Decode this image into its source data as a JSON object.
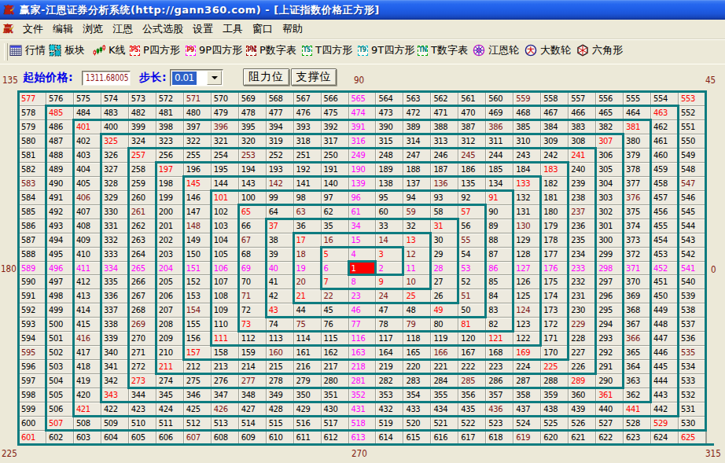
{
  "window": {
    "title": "赢家-江恩证券分析系统(http://gann360.com) - [上证指数价格正方形]",
    "app_icon": "赢"
  },
  "menu": {
    "items": [
      "文件",
      "编辑",
      "浏览",
      "江恩",
      "公式选股",
      "设置",
      "工具",
      "窗口",
      "帮助"
    ]
  },
  "toolbar": {
    "items": [
      {
        "name": "quotes",
        "label": "行情",
        "icon": "table-icon"
      },
      {
        "name": "sectors",
        "label": "板块",
        "icon": "blocks-icon"
      },
      {
        "name": "kline",
        "label": "K线",
        "icon": "candlestick-icon"
      },
      {
        "name": "p-square",
        "label": "P四方形",
        "icon": "badge-icon",
        "badge": "PS",
        "badge_text_color": "#e80000",
        "badge_border_color": "#e80000"
      },
      {
        "name": "9p-square",
        "label": "9P四方形",
        "icon": "badge-icon",
        "badge": "P9",
        "badge_text_color": "#d40000",
        "badge_border_color": "#ff00ff"
      },
      {
        "name": "p-number-table",
        "label": "P数字表",
        "icon": "badge-icon",
        "badge": "PN",
        "badge_text_color": "#8b0000",
        "badge_border_color": "#a00000"
      },
      {
        "name": "t-square",
        "label": "T四方形",
        "icon": "badge-icon",
        "badge": "TS",
        "badge_text_color": "#008080",
        "badge_border_color": "#00a800"
      },
      {
        "name": "9t-square",
        "label": "9T四方形",
        "icon": "badge-icon",
        "badge": "T9",
        "badge_text_color": "#008080",
        "badge_border_color": "#00b8c8"
      },
      {
        "name": "t-number-table",
        "label": "T数字表",
        "icon": "badge-icon",
        "badge": "TN",
        "badge_text_color": "#008080",
        "badge_border_color": "#00a800"
      },
      {
        "name": "gann-wheel",
        "label": "江恩轮",
        "icon": "wheel-icon"
      },
      {
        "name": "big-number-wheel",
        "label": "大数轮",
        "icon": "big-wheel-icon",
        "glyph": "大"
      },
      {
        "name": "hexagon",
        "label": "六角形",
        "icon": "hexagon-icon"
      }
    ]
  },
  "controls": {
    "start_price_label": "起始价格:",
    "start_price_value": "1311.68005",
    "step_label": "步长:",
    "step_value": "0.01",
    "resistance_button_label": "阻力位",
    "support_button_label": "支撑位"
  },
  "angle_labels": {
    "top_left": "135",
    "top_center": "90",
    "top_right": "45",
    "middle_left": "180",
    "middle_right": "0",
    "bottom_left": "225",
    "bottom_center": "270",
    "bottom_right": "315"
  },
  "gann_square": {
    "size": 25,
    "center_value": 1,
    "colors": {
      "cardinal_axis": "#ff00ff",
      "diagonal": "#ff0000",
      "half_angle": "#7d1414",
      "normal": "#000000",
      "ring_border": "#0e7c80",
      "center_background": "#fb0000",
      "center_text": "#ffffff"
    },
    "rows": [
      [
        577,
        576,
        575,
        574,
        573,
        572,
        571,
        570,
        569,
        568,
        567,
        566,
        565,
        564,
        563,
        562,
        561,
        560,
        559,
        558,
        557,
        556,
        555,
        554,
        553
      ],
      [
        578,
        485,
        484,
        483,
        482,
        481,
        480,
        479,
        478,
        477,
        476,
        475,
        474,
        473,
        472,
        471,
        470,
        469,
        468,
        467,
        466,
        465,
        464,
        463,
        552
      ],
      [
        579,
        486,
        401,
        400,
        399,
        398,
        397,
        396,
        395,
        394,
        393,
        392,
        391,
        390,
        389,
        388,
        387,
        386,
        385,
        384,
        383,
        382,
        381,
        462,
        551
      ],
      [
        580,
        487,
        402,
        325,
        324,
        323,
        322,
        321,
        320,
        319,
        318,
        317,
        316,
        315,
        314,
        313,
        312,
        311,
        310,
        309,
        308,
        307,
        380,
        461,
        550
      ],
      [
        581,
        488,
        403,
        326,
        257,
        256,
        255,
        254,
        253,
        252,
        251,
        250,
        249,
        248,
        247,
        246,
        245,
        244,
        243,
        242,
        241,
        306,
        379,
        460,
        549
      ],
      [
        582,
        489,
        404,
        327,
        258,
        197,
        196,
        195,
        194,
        193,
        192,
        191,
        190,
        189,
        188,
        187,
        186,
        185,
        184,
        183,
        240,
        305,
        378,
        459,
        548
      ],
      [
        583,
        490,
        405,
        328,
        259,
        198,
        145,
        144,
        143,
        142,
        141,
        140,
        139,
        138,
        137,
        136,
        135,
        134,
        133,
        182,
        239,
        304,
        377,
        458,
        547
      ],
      [
        584,
        491,
        406,
        329,
        260,
        199,
        146,
        101,
        100,
        99,
        98,
        97,
        96,
        95,
        94,
        93,
        92,
        91,
        132,
        181,
        238,
        303,
        376,
        457,
        546
      ],
      [
        585,
        492,
        407,
        330,
        261,
        200,
        147,
        102,
        65,
        64,
        63,
        62,
        61,
        60,
        59,
        58,
        57,
        90,
        131,
        180,
        237,
        302,
        375,
        456,
        545
      ],
      [
        586,
        493,
        408,
        331,
        262,
        201,
        148,
        103,
        66,
        37,
        36,
        35,
        34,
        33,
        32,
        31,
        56,
        89,
        130,
        179,
        236,
        301,
        374,
        455,
        544
      ],
      [
        587,
        494,
        409,
        332,
        263,
        202,
        149,
        104,
        67,
        38,
        17,
        16,
        15,
        14,
        13,
        30,
        55,
        88,
        129,
        178,
        235,
        300,
        373,
        454,
        543
      ],
      [
        588,
        495,
        410,
        333,
        264,
        203,
        150,
        105,
        68,
        39,
        18,
        5,
        4,
        3,
        12,
        29,
        54,
        87,
        128,
        177,
        234,
        299,
        372,
        453,
        542
      ],
      [
        589,
        496,
        411,
        334,
        265,
        204,
        151,
        106,
        69,
        40,
        19,
        6,
        1,
        2,
        11,
        28,
        53,
        86,
        127,
        176,
        233,
        298,
        371,
        452,
        541
      ],
      [
        590,
        497,
        412,
        335,
        266,
        205,
        152,
        107,
        70,
        41,
        20,
        7,
        8,
        9,
        10,
        27,
        52,
        85,
        126,
        175,
        232,
        297,
        370,
        451,
        540
      ],
      [
        591,
        498,
        413,
        336,
        267,
        206,
        153,
        108,
        71,
        42,
        21,
        22,
        23,
        24,
        25,
        26,
        51,
        84,
        125,
        174,
        231,
        296,
        369,
        450,
        539
      ],
      [
        592,
        499,
        414,
        337,
        268,
        207,
        154,
        109,
        72,
        43,
        44,
        45,
        46,
        47,
        48,
        49,
        50,
        83,
        124,
        173,
        230,
        295,
        368,
        449,
        538
      ],
      [
        593,
        500,
        415,
        338,
        269,
        208,
        155,
        110,
        73,
        74,
        75,
        76,
        77,
        78,
        79,
        80,
        81,
        82,
        123,
        172,
        229,
        294,
        367,
        448,
        537
      ],
      [
        594,
        501,
        416,
        339,
        270,
        209,
        156,
        111,
        112,
        113,
        114,
        115,
        116,
        117,
        118,
        119,
        120,
        121,
        122,
        171,
        228,
        293,
        366,
        447,
        536
      ],
      [
        595,
        502,
        417,
        340,
        271,
        210,
        157,
        158,
        159,
        160,
        161,
        162,
        163,
        164,
        165,
        166,
        167,
        168,
        169,
        170,
        227,
        292,
        365,
        446,
        535
      ],
      [
        596,
        503,
        418,
        341,
        272,
        211,
        212,
        213,
        214,
        215,
        216,
        217,
        218,
        219,
        220,
        221,
        222,
        223,
        224,
        225,
        226,
        291,
        364,
        445,
        534
      ],
      [
        597,
        504,
        419,
        342,
        273,
        274,
        275,
        276,
        277,
        278,
        279,
        280,
        281,
        282,
        283,
        284,
        285,
        286,
        287,
        288,
        289,
        290,
        363,
        444,
        533
      ],
      [
        598,
        505,
        420,
        343,
        344,
        345,
        346,
        347,
        348,
        349,
        350,
        351,
        352,
        353,
        354,
        355,
        356,
        357,
        358,
        359,
        360,
        361,
        362,
        443,
        532
      ],
      [
        599,
        506,
        421,
        422,
        423,
        424,
        425,
        426,
        427,
        428,
        429,
        430,
        431,
        432,
        433,
        434,
        435,
        436,
        437,
        438,
        439,
        440,
        441,
        442,
        531
      ],
      [
        600,
        507,
        508,
        509,
        510,
        511,
        512,
        513,
        514,
        515,
        516,
        517,
        518,
        519,
        520,
        521,
        522,
        523,
        524,
        525,
        526,
        527,
        528,
        529,
        530
      ],
      [
        601,
        602,
        603,
        604,
        605,
        606,
        607,
        608,
        609,
        610,
        611,
        612,
        613,
        614,
        615,
        616,
        617,
        618,
        619,
        620,
        621,
        622,
        623,
        624,
        625
      ]
    ]
  }
}
